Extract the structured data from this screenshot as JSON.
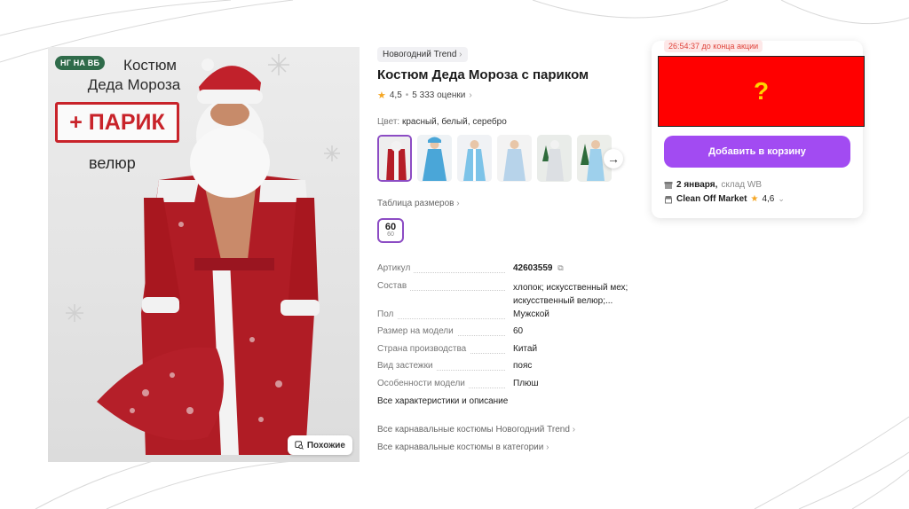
{
  "photo": {
    "badge": "НГ НА ВБ",
    "title_line1": "Костюм",
    "title_line2": "Деда Мороза",
    "wig_label": "+ ПАРИК",
    "fabric_label": "велюр",
    "similar_button": "Похожие"
  },
  "product": {
    "brand": "Новогодний Trend",
    "title": "Костюм Деда Мороза с париком",
    "rating": "4,5",
    "reviews": "5 333 оценки",
    "color_label": "Цвет:",
    "color_value": "красный, белый, серебро",
    "size_table_link": "Таблица размеров",
    "size_main": "60",
    "size_sub": "60"
  },
  "specs": [
    {
      "key": "Артикул",
      "value": "42603559"
    },
    {
      "key": "Состав",
      "value": "хлопок; искусственный мех; искусственный велюр;..."
    },
    {
      "key": "Пол",
      "value": "Мужской"
    },
    {
      "key": "Размер на модели",
      "value": "60"
    },
    {
      "key": "Страна производства",
      "value": "Китай"
    },
    {
      "key": "Вид застежки",
      "value": "пояс"
    },
    {
      "key": "Особенности модели",
      "value": "Плюш"
    }
  ],
  "all_specs_link": "Все характеристики и описание",
  "links": {
    "brand_costumes": "Все карнавальные костюмы Новогодний Trend",
    "category_costumes": "Все карнавальные костюмы в категории"
  },
  "buy_card": {
    "timer": "26:54:37 до конца акции",
    "hidden_price": "?",
    "cart_button": "Добавить в корзину",
    "delivery_date": "2 января,",
    "warehouse": "склад WB",
    "seller_name": "Clean Off Market",
    "seller_rating": "4,6"
  },
  "colors": {
    "accent": "#a24bf2",
    "redbox": "#ff0000",
    "question_mark": "#ffd400",
    "timer_text": "#e0443c",
    "star": "#f5a623"
  }
}
